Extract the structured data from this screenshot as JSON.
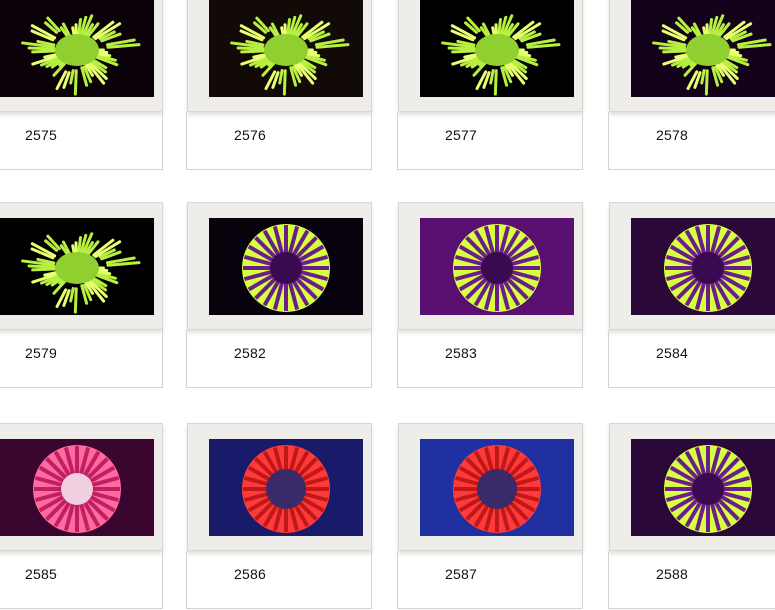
{
  "gallery": {
    "items": [
      {
        "id": "2575",
        "style": "green-polyp",
        "bg": "#0a0208"
      },
      {
        "id": "2576",
        "style": "green-polyp",
        "bg": "#120a06"
      },
      {
        "id": "2577",
        "style": "green-polyp",
        "bg": "#000000"
      },
      {
        "id": "2578",
        "style": "green-polyp",
        "bg": "#12021a"
      },
      {
        "id": "2579",
        "style": "green-polyp",
        "bg": "#000000"
      },
      {
        "id": "2582",
        "style": "purple-radial",
        "bg": "#08020c"
      },
      {
        "id": "2583",
        "style": "purple-radial",
        "bg": "#5a1070"
      },
      {
        "id": "2584",
        "style": "purple-radial",
        "bg": "#2a0838"
      },
      {
        "id": "2585",
        "style": "pink-radial",
        "bg": "#3a0630"
      },
      {
        "id": "2586",
        "style": "red-ring",
        "bg": "#1a1a6a"
      },
      {
        "id": "2587",
        "style": "red-ring",
        "bg": "#2030a0"
      },
      {
        "id": "2588",
        "style": "purple-radial",
        "bg": "#2a0838"
      }
    ]
  }
}
